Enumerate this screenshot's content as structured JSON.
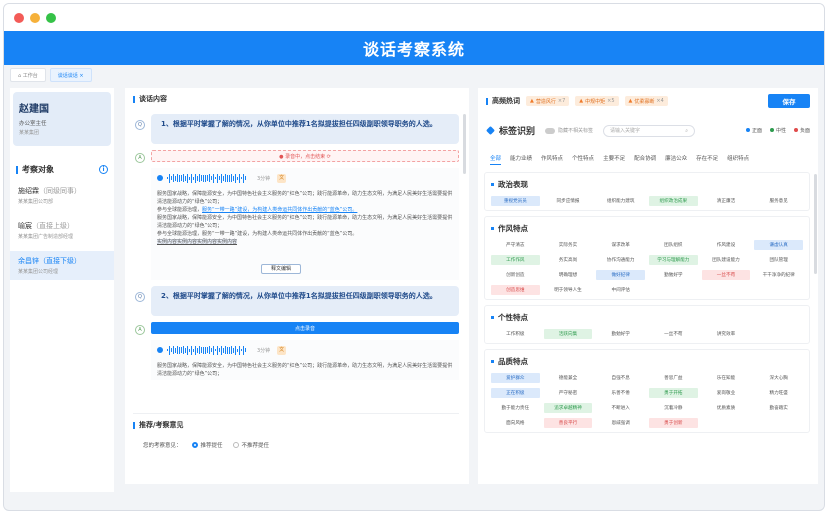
{
  "app": {
    "title": "谈话考察系统"
  },
  "tabs": [
    {
      "label": "⌂ 工作台"
    },
    {
      "label": "谈话谈话 ×"
    }
  ],
  "user": {
    "name": "赵建国",
    "title": "办公室主任",
    "dept": "某某集团"
  },
  "left": {
    "section_title": "考察对象",
    "info_icon": "info-icon",
    "people": [
      {
        "name": "施绍霖",
        "tag": "（同级同事）",
        "dept": "某某集团公司部"
      },
      {
        "name": "喻宸",
        "tag": "（直接上级）",
        "dept": "某某集团广告制造部经理"
      },
      {
        "name": "余昌锌",
        "tag": "（直接下级）",
        "dept": "某某集团公司经理"
      }
    ]
  },
  "middle": {
    "title": "谈话内容",
    "q1": "1、根据平时掌握了解的情况，从你单位中推荐1名拟提拔担任四级副职领导职务的人选。",
    "q2": "2、根据平时掌握了解的情况，从你单位中推荐1名拟提拔担任四级副职领导职务的人选。",
    "q_icon": "Q",
    "a_icon": "A",
    "recording": "● 录音中，点击结束 ⟳",
    "click_record": "点击录音",
    "duration": "3分钟",
    "t_icon": "文",
    "p1": "服务国家战略，保障能源安全，为中国特色社会主义服务的“红色”公司；践行能源革命，助力生态文明，为满足人民美好生活需要提供清洁能源动力的“绿色”公司；",
    "p2a": "参与全球能源治理，",
    "p2b": "服务“一带一路”建设，为构建人类命运共同体作出贡献的“蓝色”公司。",
    "p3": "服务国家战略，保障能源安全，为中国特色社会主义服务的“红色”公司；践行能源革命，助力生态文明，为满足人民美好生活需要提供清洁能源动力的“绿色”公司；",
    "p4": "参与全球能源治理，服务“一带一路”建设，为构建人类命运共同体作出贡献的“蓝色”公司。",
    "p5": "实例内容实例内容实例内容实例内容",
    "popup": "释文编辑",
    "p6": "服务国家战略，保障能源安全，为中国特色社会主义服务的“红色”公司；践行能源革命，助力生态文明，为满足人民美好生活需要提供清洁能源动力的“绿色”公司；",
    "rec_title": "推荐/考察意见",
    "rec_label": "您的考察意见：",
    "opt1": "推荐提任",
    "opt2": "不推荐提任"
  },
  "right": {
    "hot_title": "高频热词",
    "hot": [
      {
        "label": "营造风行",
        "count": "×7"
      },
      {
        "label": "中规中矩",
        "count": "×5"
      },
      {
        "label": "优柔寡断",
        "count": "×4"
      }
    ],
    "save": "保存",
    "tag_title": "标签识别",
    "toggle_label": "隐藏不相关标签",
    "search_placeholder": "请输入关键字",
    "legend": [
      {
        "label": "正面",
        "color": "#1783f5"
      },
      {
        "label": "中性",
        "color": "#2e9b4e"
      },
      {
        "label": "负面",
        "color": "#e04b4b"
      }
    ],
    "categories": [
      "全部",
      "能力业绩",
      "作风特点",
      "个性特点",
      "主要不足",
      "配合协调",
      "廉洁公众",
      "存在不足",
      "组织特点"
    ],
    "groups": [
      {
        "title": "政治表现",
        "tags": [
          {
            "t": "重视党员员",
            "c": "b"
          },
          {
            "t": "同步应情报",
            "c": ""
          },
          {
            "t": "组织能力建筑",
            "c": ""
          },
          {
            "t": "组织政治成果",
            "c": "g"
          },
          {
            "t": "清正廉洁",
            "c": ""
          },
          {
            "t": "服务意见",
            "c": ""
          }
        ]
      },
      {
        "title": "作风特点",
        "tags": [
          {
            "t": "严守清志",
            "c": ""
          },
          {
            "t": "实际务实",
            "c": ""
          },
          {
            "t": "谋求改革",
            "c": ""
          },
          {
            "t": "团队组织",
            "c": ""
          },
          {
            "t": "作风建设",
            "c": ""
          },
          {
            "t": "谦虚认真",
            "c": "b"
          },
          {
            "t": "工作作风",
            "c": "g"
          },
          {
            "t": "务实高尚",
            "c": ""
          },
          {
            "t": "协作沟通能力",
            "c": ""
          },
          {
            "t": "学习与理解能力",
            "c": "g"
          },
          {
            "t": "团队建设能力",
            "c": ""
          },
          {
            "t": "团队管理",
            "c": ""
          },
          {
            "t": "创新创造",
            "c": ""
          },
          {
            "t": "明确理想",
            "c": ""
          },
          {
            "t": "做好纪律",
            "c": "b"
          },
          {
            "t": "勤勉好学",
            "c": ""
          },
          {
            "t": "一丝不苟",
            "c": "r"
          },
          {
            "t": "干干净净的纪律",
            "c": ""
          },
          {
            "t": "创造思维",
            "c": "r"
          },
          {
            "t": "明于领导人生",
            "c": ""
          },
          {
            "t": "中间评估",
            "c": ""
          }
        ]
      },
      {
        "title": "个性特点",
        "tags": [
          {
            "t": "工作积极",
            "c": ""
          },
          {
            "t": "活跃向集",
            "c": "g"
          },
          {
            "t": "勤勉好学",
            "c": ""
          },
          {
            "t": "一丝不苟",
            "c": ""
          },
          {
            "t": "讲究效率",
            "c": ""
          }
        ]
      },
      {
        "title": "品质特点",
        "tags": [
          {
            "t": "爱护群众",
            "c": "b"
          },
          {
            "t": "德能兼全",
            "c": ""
          },
          {
            "t": "自强不息",
            "c": ""
          },
          {
            "t": "善思广益",
            "c": ""
          },
          {
            "t": "乐在知能",
            "c": ""
          },
          {
            "t": "深大心胸",
            "c": ""
          },
          {
            "t": "正在积极",
            "c": "b"
          },
          {
            "t": "严守秘密",
            "c": ""
          },
          {
            "t": "乐善不倦",
            "c": ""
          },
          {
            "t": "勇于开拓",
            "c": "g"
          },
          {
            "t": "爱岗敬业",
            "c": ""
          },
          {
            "t": "精力旺盛",
            "c": ""
          },
          {
            "t": "勤于能力责任",
            "c": ""
          },
          {
            "t": "追求卓越精神",
            "c": "g"
          },
          {
            "t": "不断进入",
            "c": ""
          },
          {
            "t": "沉着冷静",
            "c": ""
          },
          {
            "t": "优质素质",
            "c": ""
          },
          {
            "t": "勤奋踏实",
            "c": ""
          },
          {
            "t": "面向风格",
            "c": ""
          },
          {
            "t": "善良平行",
            "c": "r"
          },
          {
            "t": "恩威强调",
            "c": ""
          },
          {
            "t": "勇于创新",
            "c": "r"
          }
        ]
      }
    ]
  }
}
